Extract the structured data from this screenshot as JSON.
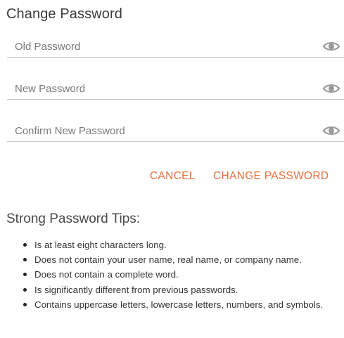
{
  "form": {
    "title": "Change Password",
    "fields": [
      {
        "placeholder": "Old Password",
        "value": "",
        "icon": "eye-icon"
      },
      {
        "placeholder": "New Password",
        "value": "",
        "icon": "eye-icon"
      },
      {
        "placeholder": "Confirm New Password",
        "value": "",
        "icon": "eye-icon"
      }
    ],
    "cancel_label": "CANCEL",
    "submit_label": "CHANGE PASSWORD"
  },
  "tips": {
    "title": "Strong Password Tips:",
    "items": [
      "Is at least eight characters long.",
      "Does not contain your user name, real name, or company name.",
      "Does not contain a complete word.",
      "Is significantly different from previous passwords.",
      "Contains uppercase letters, lowercase letters, numbers, and symbols."
    ]
  },
  "colors": {
    "accent": "#e8703a",
    "underline": "#c8c8c8",
    "icon": "#9a9a9a"
  }
}
